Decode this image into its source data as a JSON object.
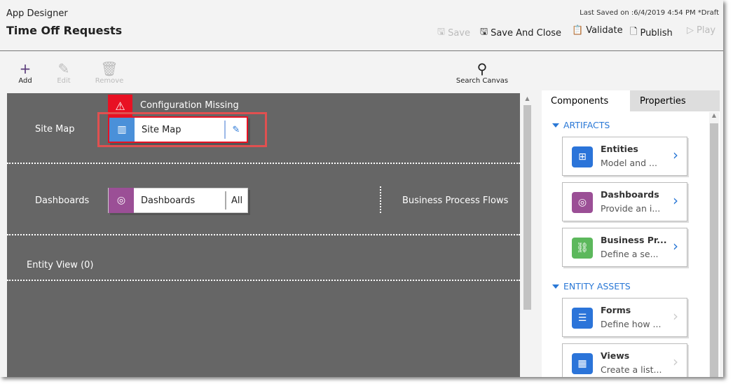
{
  "header": {
    "app_title": "App Designer",
    "page_title": "Time Off Requests",
    "last_saved": "Last Saved on :6/4/2019 4:54 PM *Draft",
    "commands": {
      "save": "Save",
      "save_and_close": "Save And Close",
      "validate": "Validate",
      "publish": "Publish",
      "play": "Play"
    }
  },
  "toolbar": {
    "add": "Add",
    "edit": "Edit",
    "remove": "Remove",
    "search_canvas": "Search Canvas"
  },
  "canvas": {
    "site_map": {
      "label": "Site Map",
      "card": "Site Map",
      "warning": "Configuration Missing",
      "color": "#4a90d9"
    },
    "dashboards": {
      "label": "Dashboards",
      "card": "Dashboards",
      "action": "All",
      "color": "#9b4f96"
    },
    "bpf": {
      "label": "Business Process Flows"
    },
    "entity_view": {
      "label": "Entity View (0)"
    },
    "error_color": "#e81123"
  },
  "panel": {
    "tabs": [
      "Components",
      "Properties"
    ],
    "active_tab": "Components",
    "sections": [
      {
        "title": "ARTIFACTS",
        "items": [
          {
            "title": "Entities",
            "desc": "Model and ...",
            "icon": "entities-icon",
            "color": "#2b74d9"
          },
          {
            "title": "Dashboards",
            "desc": "Provide an i...",
            "icon": "dashboard-icon",
            "color": "#9b4f96"
          },
          {
            "title": "Business Pr...",
            "desc": "Define a se...",
            "icon": "process-flow-icon",
            "color": "#5cb85c"
          }
        ]
      },
      {
        "title": "ENTITY ASSETS",
        "items": [
          {
            "title": "Forms",
            "desc": "Define how ...",
            "icon": "form-icon",
            "color": "#2b74d9"
          },
          {
            "title": "Views",
            "desc": "Create a list...",
            "icon": "grid-icon",
            "color": "#2b74d9"
          }
        ]
      }
    ]
  }
}
